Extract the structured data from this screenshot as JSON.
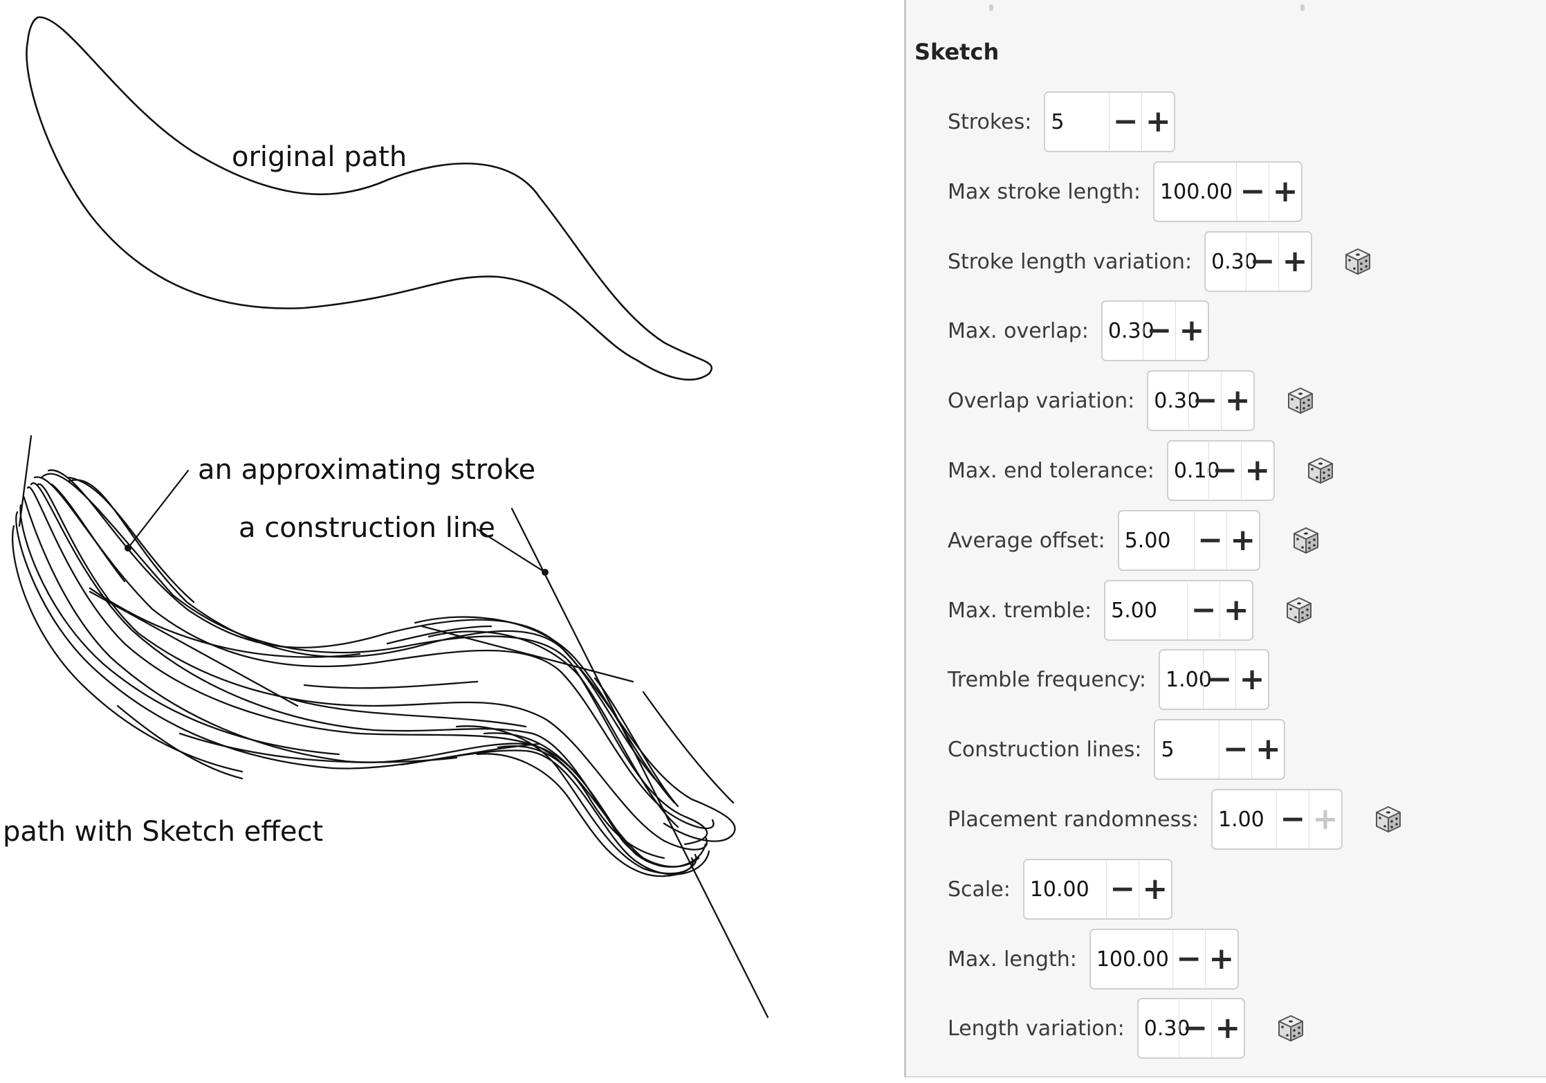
{
  "illustration": {
    "labels": {
      "original_path": "original path",
      "approx_stroke": "an approximating stroke",
      "construction_line": "a construction line",
      "sketch_effect": "path with Sketch effect"
    }
  },
  "panel": {
    "title": "Sketch",
    "params": [
      {
        "label": "Strokes:",
        "value": "5",
        "randomize": false,
        "plus_enabled": true
      },
      {
        "label": "Max stroke length:",
        "value": "100.00",
        "randomize": false,
        "plus_enabled": true
      },
      {
        "label": "Stroke length variation:",
        "value": "0.30",
        "randomize": true,
        "plus_enabled": true
      },
      {
        "label": "Max. overlap:",
        "value": "0.30",
        "randomize": false,
        "plus_enabled": true
      },
      {
        "label": "Overlap variation:",
        "value": "0.30",
        "randomize": true,
        "plus_enabled": true
      },
      {
        "label": "Max. end tolerance:",
        "value": "0.10",
        "randomize": true,
        "plus_enabled": true
      },
      {
        "label": "Average offset:",
        "value": "5.00",
        "randomize": true,
        "plus_enabled": true
      },
      {
        "label": "Max. tremble:",
        "value": "5.00",
        "randomize": true,
        "plus_enabled": true
      },
      {
        "label": "Tremble frequency:",
        "value": "1.00",
        "randomize": false,
        "plus_enabled": true
      },
      {
        "label": "Construction lines:",
        "value": "5",
        "randomize": false,
        "plus_enabled": true
      },
      {
        "label": "Placement randomness:",
        "value": "1.00",
        "randomize": true,
        "plus_enabled": false
      },
      {
        "label": "Scale:",
        "value": "10.00",
        "randomize": false,
        "plus_enabled": true
      },
      {
        "label": "Max. length:",
        "value": "100.00",
        "randomize": false,
        "plus_enabled": true
      },
      {
        "label": "Length variation:",
        "value": "0.30",
        "randomize": true,
        "plus_enabled": true
      }
    ],
    "minus_glyph": "−",
    "plus_glyph": "+",
    "icons": {
      "randomize": "dice-icon",
      "decrement": "minus-icon",
      "increment": "plus-icon"
    }
  }
}
